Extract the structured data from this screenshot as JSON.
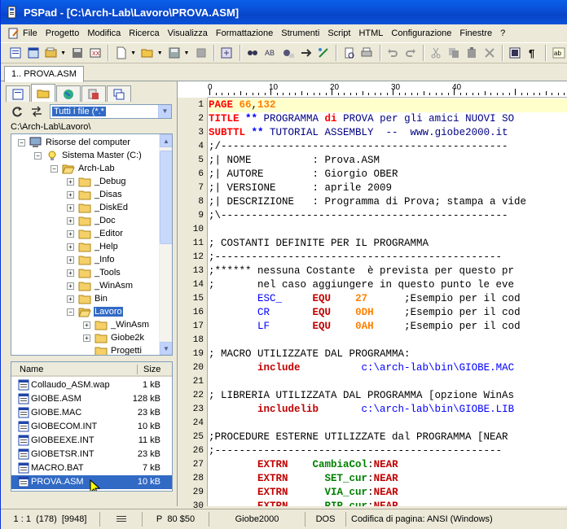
{
  "title": "PSPad - [C:\\Arch-Lab\\Lavoro\\PROVA.ASM]",
  "menu": [
    "File",
    "Progetto",
    "Modifica",
    "Ricerca",
    "Visualizza",
    "Formattazione",
    "Strumenti",
    "Script",
    "HTML",
    "Configurazione",
    "Finestre",
    "?"
  ],
  "doc_tab": "1.. PROVA.ASM",
  "filter": "Tutti i file (*.*",
  "current_path": "C:\\Arch-Lab\\Lavoro\\",
  "tree": [
    {
      "label": "Risorse del computer",
      "level": 0,
      "icon": "computer-icon",
      "pm": "−"
    },
    {
      "label": "Sistema Master (C:)",
      "level": 1,
      "icon": "drive-icon",
      "pm": "−"
    },
    {
      "label": "Arch-Lab",
      "level": 2,
      "icon": "folder-open-icon",
      "pm": "−"
    },
    {
      "label": "_Debug",
      "level": 3,
      "icon": "folder-icon",
      "pm": "+"
    },
    {
      "label": "_Disas",
      "level": 3,
      "icon": "folder-icon",
      "pm": "+"
    },
    {
      "label": "_DiskEd",
      "level": 3,
      "icon": "folder-icon",
      "pm": "+"
    },
    {
      "label": "_Doc",
      "level": 3,
      "icon": "folder-icon",
      "pm": "+"
    },
    {
      "label": "_Editor",
      "level": 3,
      "icon": "folder-icon",
      "pm": "+"
    },
    {
      "label": "_Help",
      "level": 3,
      "icon": "folder-icon",
      "pm": "+"
    },
    {
      "label": "_Info",
      "level": 3,
      "icon": "folder-icon",
      "pm": "+"
    },
    {
      "label": "_Tools",
      "level": 3,
      "icon": "folder-icon",
      "pm": "+"
    },
    {
      "label": "_WinAsm",
      "level": 3,
      "icon": "folder-icon",
      "pm": "+"
    },
    {
      "label": "Bin",
      "level": 3,
      "icon": "folder-icon",
      "pm": "+"
    },
    {
      "label": "Lavoro",
      "level": 3,
      "icon": "folder-open-icon",
      "pm": "−",
      "selected": true
    },
    {
      "label": "_WinAsm",
      "level": 4,
      "icon": "folder-icon",
      "pm": "+"
    },
    {
      "label": "Giobe2k",
      "level": 4,
      "icon": "folder-icon",
      "pm": "+"
    },
    {
      "label": "Progetti",
      "level": 4,
      "icon": "folder-icon",
      "pm": ""
    }
  ],
  "files_header": {
    "name": "Name",
    "size": "Size"
  },
  "files": [
    {
      "name": "Collaudo_ASM.wap",
      "size": "1 kB"
    },
    {
      "name": "GIOBE.ASM",
      "size": "128 kB"
    },
    {
      "name": "GIOBE.MAC",
      "size": "23 kB"
    },
    {
      "name": "GIOBECOM.INT",
      "size": "10 kB"
    },
    {
      "name": "GIOBEEXE.INT",
      "size": "11 kB"
    },
    {
      "name": "GIOBETSR.INT",
      "size": "23 kB"
    },
    {
      "name": "MACRO.BAT",
      "size": "7 kB"
    },
    {
      "name": "PROVA.ASM",
      "size": "10 kB",
      "selected": true
    }
  ],
  "ruler_numbers": [
    "0",
    "10",
    "20",
    "30",
    "40"
  ],
  "code_lines": [
    {
      "n": "1",
      "cur": true,
      "segs": [
        [
          "kw",
          "PAGE "
        ],
        [
          "num",
          "66"
        ],
        [
          "pl",
          ","
        ],
        [
          "num",
          "132"
        ]
      ]
    },
    {
      "n": "2",
      "segs": [
        [
          "kw",
          "TITLE "
        ],
        [
          "op",
          "** "
        ],
        [
          "cm",
          "PROGRAMMA "
        ],
        [
          "kw",
          "di "
        ],
        [
          "cm",
          "PROVA per gli amici NUOVI SO"
        ]
      ]
    },
    {
      "n": "3",
      "segs": [
        [
          "kw",
          "SUBTTL "
        ],
        [
          "op",
          "** "
        ],
        [
          "cm",
          "TUTORIAL ASSEMBLY  --  www.giobe2000.it"
        ]
      ]
    },
    {
      "n": "4",
      "segs": [
        [
          "pl",
          ";/-----------------------------------------------"
        ]
      ]
    },
    {
      "n": "5",
      "segs": [
        [
          "pl",
          ";| NOME          : Prova.ASM"
        ]
      ]
    },
    {
      "n": "6",
      "segs": [
        [
          "pl",
          ";| AUTORE        : Giorgio OBER"
        ]
      ]
    },
    {
      "n": "7",
      "segs": [
        [
          "pl",
          ";| VERSIONE      : aprile 2009"
        ]
      ]
    },
    {
      "n": "8",
      "segs": [
        [
          "pl",
          ";| DESCRIZIONE   : Programma di Prova; stampa a vide"
        ]
      ]
    },
    {
      "n": "9",
      "segs": [
        [
          "pl",
          ";\\-----------------------------------------------"
        ]
      ]
    },
    {
      "n": "10",
      "segs": []
    },
    {
      "n": "11",
      "segs": [
        [
          "pl",
          "; COSTANTI DEFINITE PER IL PROGRAMMA"
        ]
      ]
    },
    {
      "n": "12",
      "segs": [
        [
          "pl",
          ";-----------------------------------------------"
        ]
      ]
    },
    {
      "n": "13",
      "segs": [
        [
          "pl",
          ";****** nessuna Costante  è prevista per questo pr"
        ]
      ]
    },
    {
      "n": "14",
      "segs": [
        [
          "pl",
          ";       nel caso aggiungere in questo punto le eve"
        ]
      ]
    },
    {
      "n": "15",
      "segs": [
        [
          "pl",
          "        "
        ],
        [
          "str",
          "ESC_"
        ],
        [
          "pl",
          "     "
        ],
        [
          "dir",
          "EQU"
        ],
        [
          "pl",
          "    "
        ],
        [
          "num",
          "27"
        ],
        [
          "pl",
          "      ;Esempio per il cod"
        ]
      ]
    },
    {
      "n": "16",
      "segs": [
        [
          "pl",
          "        "
        ],
        [
          "str",
          "CR"
        ],
        [
          "pl",
          "       "
        ],
        [
          "dir",
          "EQU"
        ],
        [
          "pl",
          "    "
        ],
        [
          "num",
          "0DH"
        ],
        [
          "pl",
          "     ;Esempio per il cod"
        ]
      ]
    },
    {
      "n": "17",
      "segs": [
        [
          "pl",
          "        "
        ],
        [
          "str",
          "LF"
        ],
        [
          "pl",
          "       "
        ],
        [
          "dir",
          "EQU"
        ],
        [
          "pl",
          "    "
        ],
        [
          "num",
          "0AH"
        ],
        [
          "pl",
          "     ;Esempio per il cod"
        ]
      ]
    },
    {
      "n": "18",
      "segs": []
    },
    {
      "n": "19",
      "segs": [
        [
          "pl",
          "; MACRO UTILIZZATE DAL PROGRAMMA:"
        ]
      ]
    },
    {
      "n": "20",
      "segs": [
        [
          "pl",
          "        "
        ],
        [
          "dir",
          "include"
        ],
        [
          "pl",
          "          "
        ],
        [
          "str",
          "c:\\arch-lab\\bin\\GIOBE.MAC"
        ]
      ]
    },
    {
      "n": "21",
      "segs": []
    },
    {
      "n": "22",
      "segs": [
        [
          "pl",
          "; LIBRERIA UTILIZZATA DAL PROGRAMMA [opzione WinAs"
        ]
      ]
    },
    {
      "n": "23",
      "segs": [
        [
          "pl",
          "        "
        ],
        [
          "dir",
          "includelib"
        ],
        [
          "pl",
          "       "
        ],
        [
          "str",
          "c:\\arch-lab\\bin\\GIOBE.LIB"
        ]
      ]
    },
    {
      "n": "24",
      "segs": []
    },
    {
      "n": "25",
      "segs": [
        [
          "pl",
          ";PROCEDURE ESTERNE UTILIZZATE dal PROGRAMMA [NEAR"
        ]
      ]
    },
    {
      "n": "26",
      "segs": [
        [
          "pl",
          ";-----------------------------------------------"
        ]
      ]
    },
    {
      "n": "27",
      "segs": [
        [
          "pl",
          "        "
        ],
        [
          "dir",
          "EXTRN"
        ],
        [
          "pl",
          "    "
        ],
        [
          "lab",
          "CambiaCol"
        ],
        [
          "pl",
          ":"
        ],
        [
          "dir",
          "NEAR"
        ]
      ]
    },
    {
      "n": "28",
      "segs": [
        [
          "pl",
          "        "
        ],
        [
          "dir",
          "EXTRN"
        ],
        [
          "pl",
          "      "
        ],
        [
          "lab",
          "SET_cur"
        ],
        [
          "pl",
          ":"
        ],
        [
          "dir",
          "NEAR"
        ]
      ]
    },
    {
      "n": "29",
      "segs": [
        [
          "pl",
          "        "
        ],
        [
          "dir",
          "EXTRN"
        ],
        [
          "pl",
          "      "
        ],
        [
          "lab",
          "VIA_cur"
        ],
        [
          "pl",
          ":"
        ],
        [
          "dir",
          "NEAR"
        ]
      ]
    },
    {
      "n": "30",
      "segs": [
        [
          "pl",
          "        "
        ],
        [
          "dir",
          "EXTRN"
        ],
        [
          "pl",
          "      "
        ],
        [
          "lab",
          "RIP_cur"
        ],
        [
          "pl",
          ":"
        ],
        [
          "dir",
          "NEAR"
        ]
      ]
    }
  ],
  "status": {
    "pos": "1 : 1",
    "count": "(178)",
    "bytes": "[9948]",
    "p": "P",
    "pval": "80",
    "hex": "$50",
    "scheme": "Giobe2000",
    "eol": "DOS",
    "encoding": "Codifica di pagina: ANSI (Windows)"
  }
}
